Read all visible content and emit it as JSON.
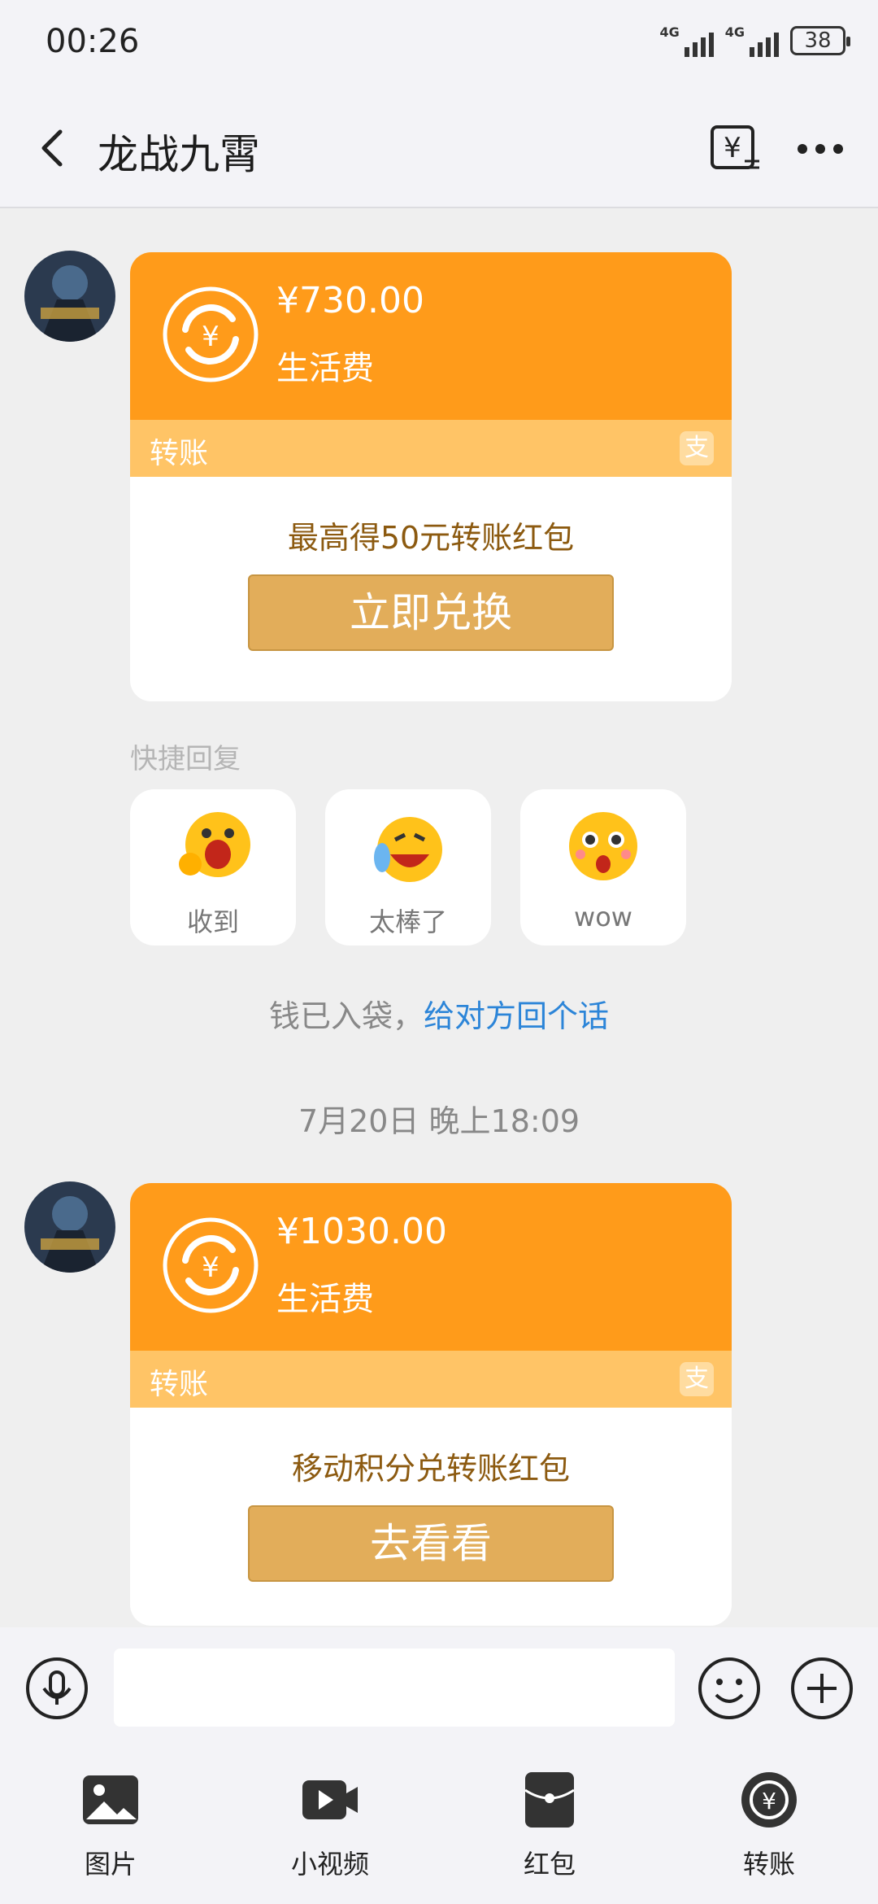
{
  "status_bar": {
    "time": "00:26",
    "signal1": "4G",
    "signal2": "4G",
    "battery": "38"
  },
  "header": {
    "title": "龙战九霄",
    "transfer_icon": "yuan-transfer-icon",
    "more_icon": "more-dots-icon"
  },
  "messages": [
    {
      "amount": "¥730.00",
      "memo": "生活费",
      "band_label": "转账",
      "promo": "最高得50元转账红包",
      "button": "立即兑换"
    },
    {
      "amount": "¥1030.00",
      "memo": "生活费",
      "band_label": "转账",
      "promo": "移动积分兑转账红包",
      "button": "去看看"
    }
  ],
  "quick_reply": {
    "label": "快捷回复",
    "items": [
      {
        "label": "收到"
      },
      {
        "label": "太棒了"
      },
      {
        "label": "wow"
      }
    ]
  },
  "system": {
    "text": "钱已入袋，",
    "link": "给对方回个话"
  },
  "timestamp": "7月20日 晚上18:09",
  "bottom_nav": [
    {
      "label": "图片"
    },
    {
      "label": "小视频"
    },
    {
      "label": "红包"
    },
    {
      "label": "转账"
    }
  ],
  "colors": {
    "accent": "#ff9b1a",
    "band": "#ffc466",
    "button": "#e2ad5a",
    "link": "#2c85d8"
  }
}
